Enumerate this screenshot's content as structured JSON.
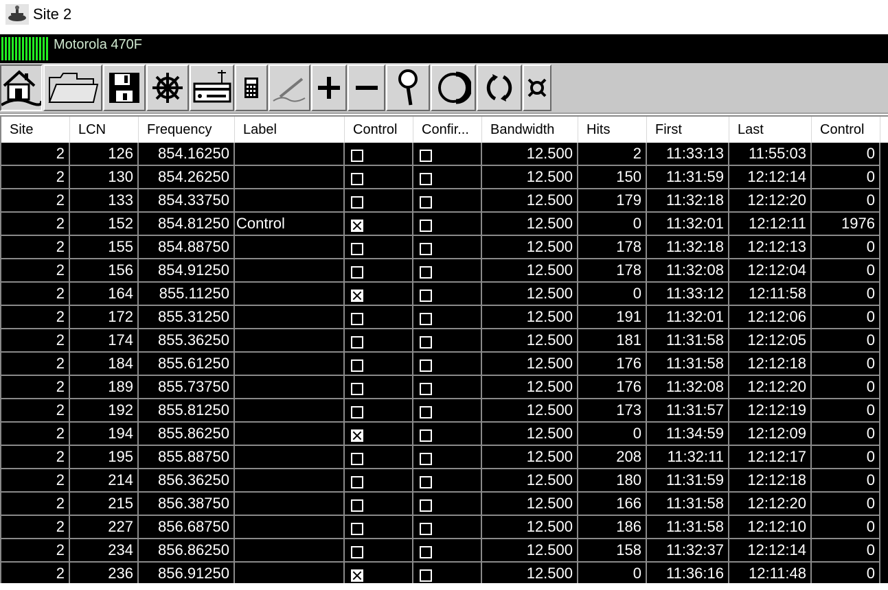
{
  "window": {
    "title": "Site 2",
    "icon": "site-radio-icon"
  },
  "device": {
    "name": "Motorola 470F",
    "signal_color": "#22ee22"
  },
  "toolbar": {
    "buttons": [
      {
        "name": "home-button",
        "icon": "home-icon"
      },
      {
        "name": "open-button",
        "icon": "folder-icon"
      },
      {
        "name": "save-button",
        "icon": "floppy-disk-icon"
      },
      {
        "name": "ship-wheel-button",
        "icon": "ship-wheel-icon"
      },
      {
        "name": "receiver-button",
        "icon": "radio-receiver-icon"
      },
      {
        "name": "calculator-button",
        "icon": "calculator-icon"
      },
      {
        "name": "edit-button",
        "icon": "pen-icon"
      },
      {
        "name": "add-button",
        "icon": "plus-icon"
      },
      {
        "name": "remove-button",
        "icon": "minus-icon"
      },
      {
        "name": "search-button",
        "icon": "magnifier-icon"
      },
      {
        "name": "circle-button",
        "icon": "circle-icon"
      },
      {
        "name": "refresh-button",
        "icon": "refresh-icon"
      },
      {
        "name": "settings-button",
        "icon": "special-symbol-icon"
      }
    ]
  },
  "table": {
    "columns": [
      "Site",
      "LCN",
      "Frequency",
      "Label",
      "Control",
      "Confir...",
      "Bandwidth",
      "Hits",
      "First",
      "Last",
      "Control"
    ],
    "rows": [
      [
        "2",
        "126",
        "854.16250",
        "",
        false,
        false,
        "12.500",
        "2",
        "11:33:13",
        "11:55:03",
        "0"
      ],
      [
        "2",
        "130",
        "854.26250",
        "",
        false,
        false,
        "12.500",
        "150",
        "11:31:59",
        "12:12:14",
        "0"
      ],
      [
        "2",
        "133",
        "854.33750",
        "",
        false,
        false,
        "12.500",
        "179",
        "11:32:18",
        "12:12:20",
        "0"
      ],
      [
        "2",
        "152",
        "854.81250",
        "Control",
        true,
        false,
        "12.500",
        "0",
        "11:32:01",
        "12:12:11",
        "1976"
      ],
      [
        "2",
        "155",
        "854.88750",
        "",
        false,
        false,
        "12.500",
        "178",
        "11:32:18",
        "12:12:13",
        "0"
      ],
      [
        "2",
        "156",
        "854.91250",
        "",
        false,
        false,
        "12.500",
        "178",
        "11:32:08",
        "12:12:04",
        "0"
      ],
      [
        "2",
        "164",
        "855.11250",
        "",
        true,
        false,
        "12.500",
        "0",
        "11:33:12",
        "12:11:58",
        "0"
      ],
      [
        "2",
        "172",
        "855.31250",
        "",
        false,
        false,
        "12.500",
        "191",
        "11:32:01",
        "12:12:06",
        "0"
      ],
      [
        "2",
        "174",
        "855.36250",
        "",
        false,
        false,
        "12.500",
        "181",
        "11:31:58",
        "12:12:05",
        "0"
      ],
      [
        "2",
        "184",
        "855.61250",
        "",
        false,
        false,
        "12.500",
        "176",
        "11:31:58",
        "12:12:18",
        "0"
      ],
      [
        "2",
        "189",
        "855.73750",
        "",
        false,
        false,
        "12.500",
        "176",
        "11:32:08",
        "12:12:20",
        "0"
      ],
      [
        "2",
        "192",
        "855.81250",
        "",
        false,
        false,
        "12.500",
        "173",
        "11:31:57",
        "12:12:19",
        "0"
      ],
      [
        "2",
        "194",
        "855.86250",
        "",
        true,
        false,
        "12.500",
        "0",
        "11:34:59",
        "12:12:09",
        "0"
      ],
      [
        "2",
        "195",
        "855.88750",
        "",
        false,
        false,
        "12.500",
        "208",
        "11:32:11",
        "12:12:17",
        "0"
      ],
      [
        "2",
        "214",
        "856.36250",
        "",
        false,
        false,
        "12.500",
        "180",
        "11:31:59",
        "12:12:18",
        "0"
      ],
      [
        "2",
        "215",
        "856.38750",
        "",
        false,
        false,
        "12.500",
        "166",
        "11:31:58",
        "12:12:20",
        "0"
      ],
      [
        "2",
        "227",
        "856.68750",
        "",
        false,
        false,
        "12.500",
        "186",
        "11:31:58",
        "12:12:10",
        "0"
      ],
      [
        "2",
        "234",
        "856.86250",
        "",
        false,
        false,
        "12.500",
        "158",
        "11:32:37",
        "12:12:14",
        "0"
      ],
      [
        "2",
        "236",
        "856.91250",
        "",
        true,
        false,
        "12.500",
        "0",
        "11:36:16",
        "12:11:48",
        "0"
      ]
    ]
  }
}
